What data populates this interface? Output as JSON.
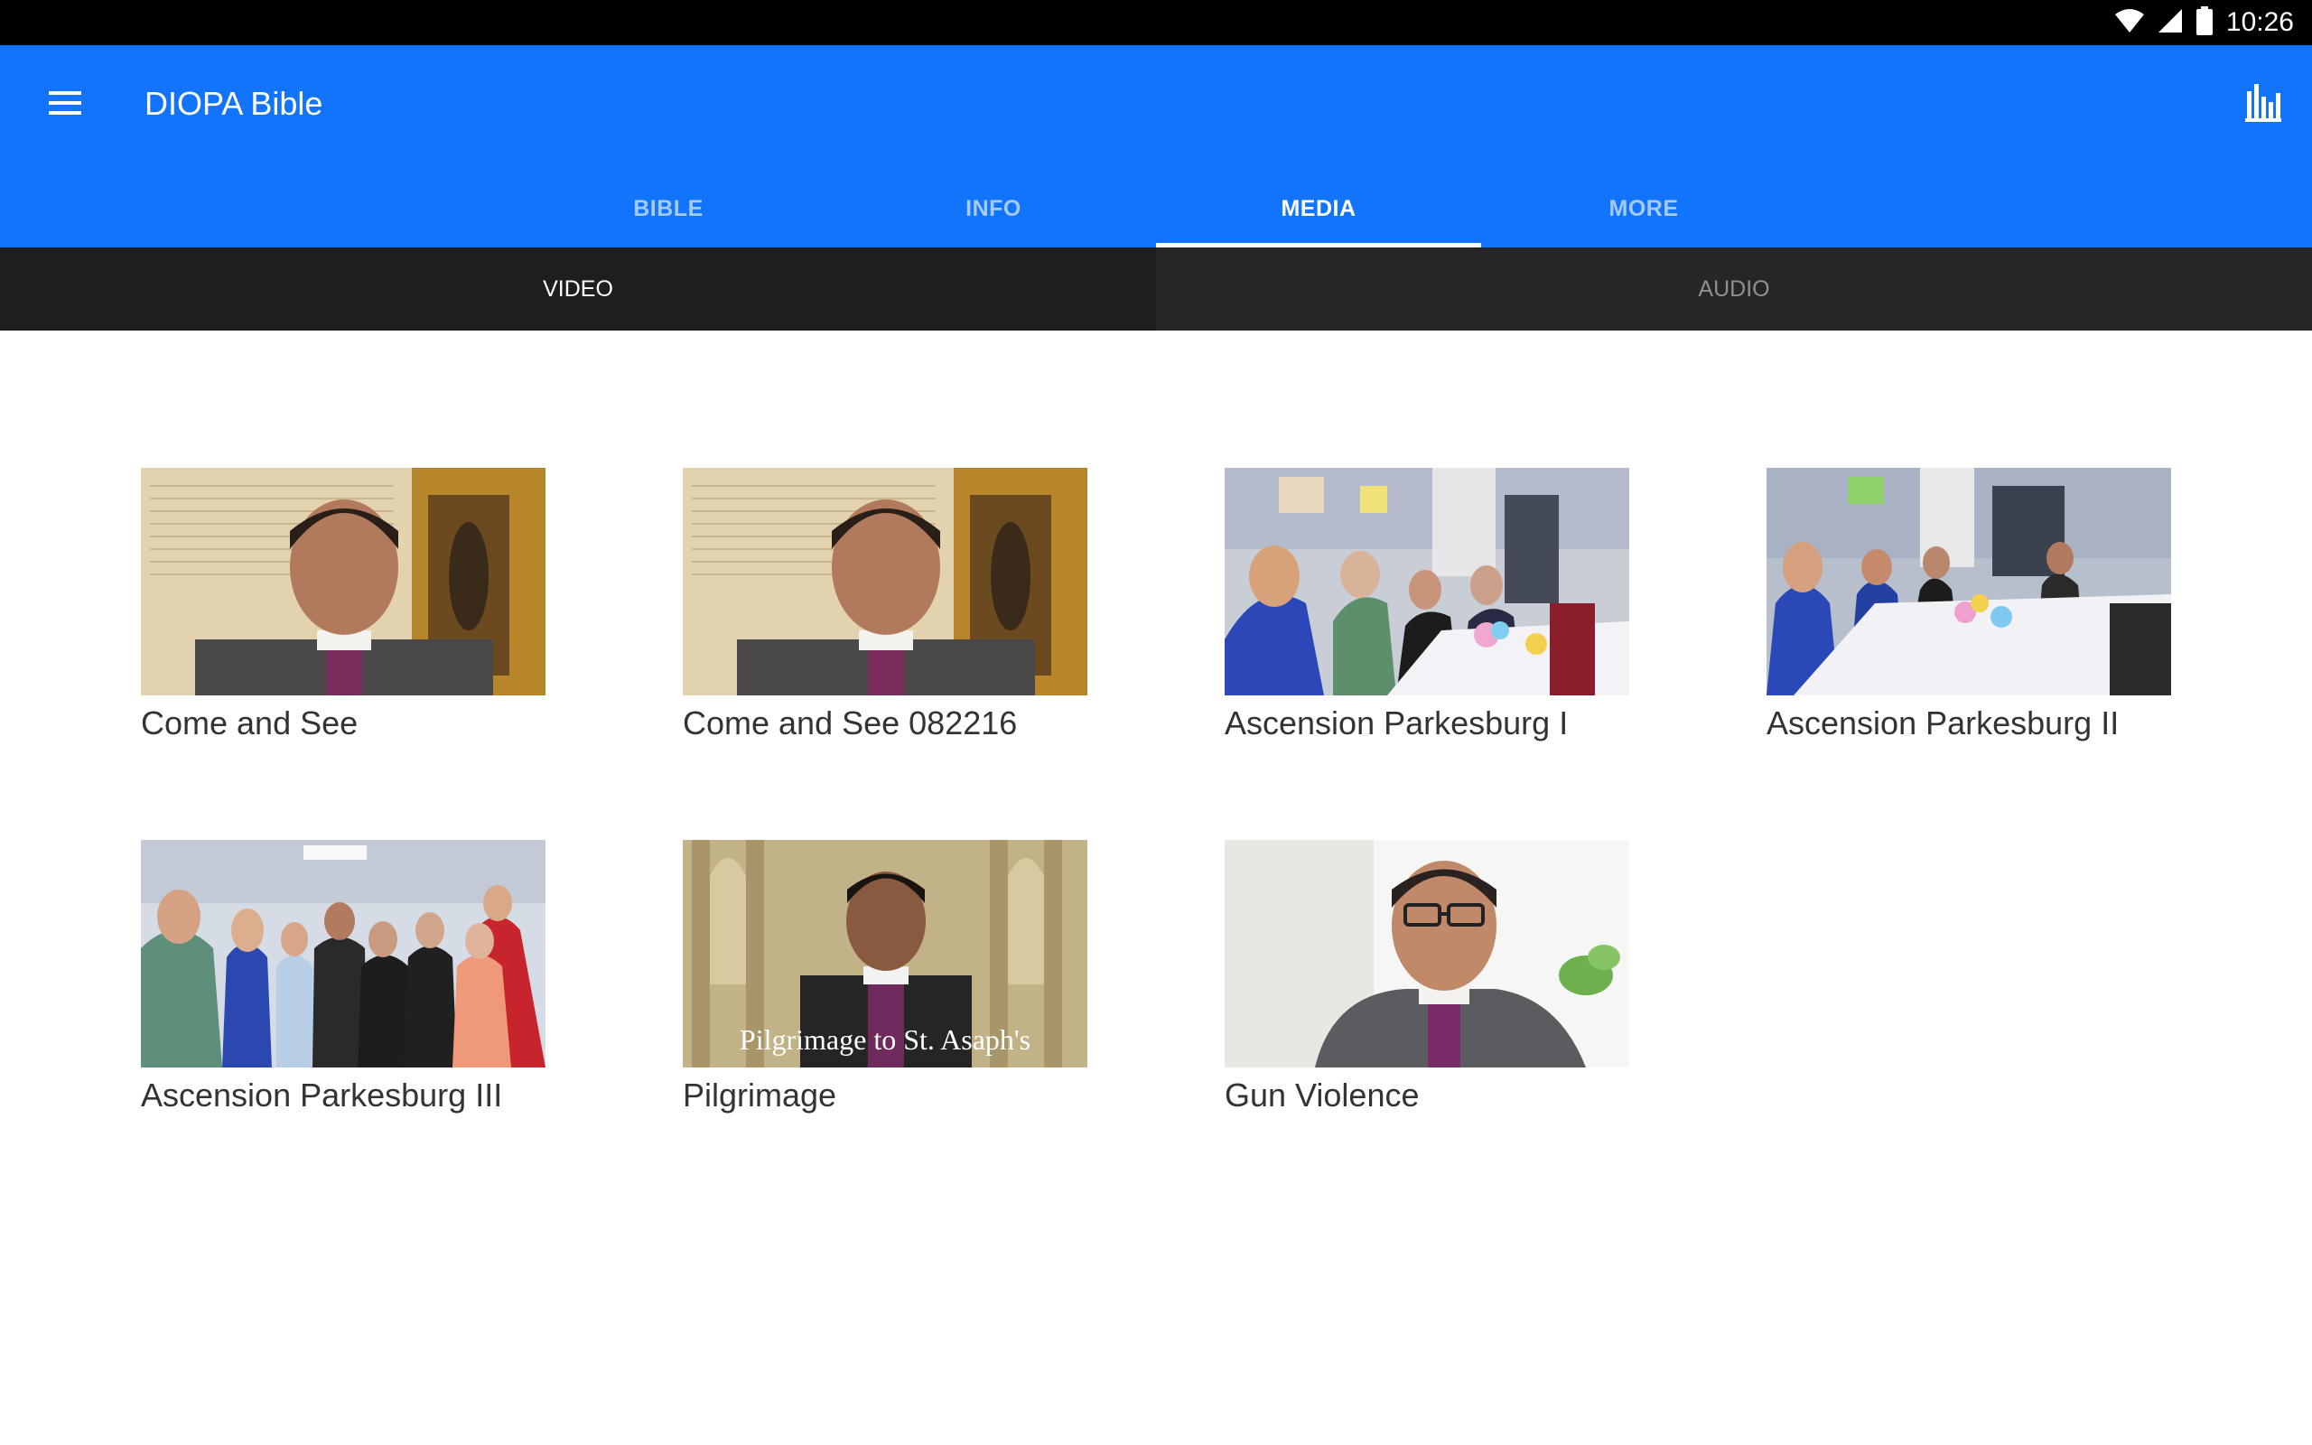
{
  "status_bar": {
    "time": "10:26",
    "icons": [
      "wifi-icon",
      "cell-signal-icon",
      "battery-icon"
    ]
  },
  "app_bar": {
    "title": "DIOPA Bible",
    "menu_icon": "hamburger-menu-icon",
    "action_icon": "bar-chart-icon",
    "color": "#1174fb"
  },
  "tabs": [
    {
      "label": "BIBLE",
      "active": false
    },
    {
      "label": "INFO",
      "active": false
    },
    {
      "label": "MEDIA",
      "active": true
    },
    {
      "label": "MORE",
      "active": false
    }
  ],
  "sub_tabs": [
    {
      "label": "VIDEO",
      "active": true
    },
    {
      "label": "AUDIO",
      "active": false
    }
  ],
  "videos": [
    {
      "title": "Come and See"
    },
    {
      "title": "Come and See 082216"
    },
    {
      "title": "Ascension Parkesburg I"
    },
    {
      "title": "Ascension Parkesburg II"
    },
    {
      "title": "Ascension Parkesburg III"
    },
    {
      "title": "Pilgrimage",
      "overlay_text": "Pilgrimage to St. Asaph's"
    },
    {
      "title": "Gun Violence"
    }
  ]
}
